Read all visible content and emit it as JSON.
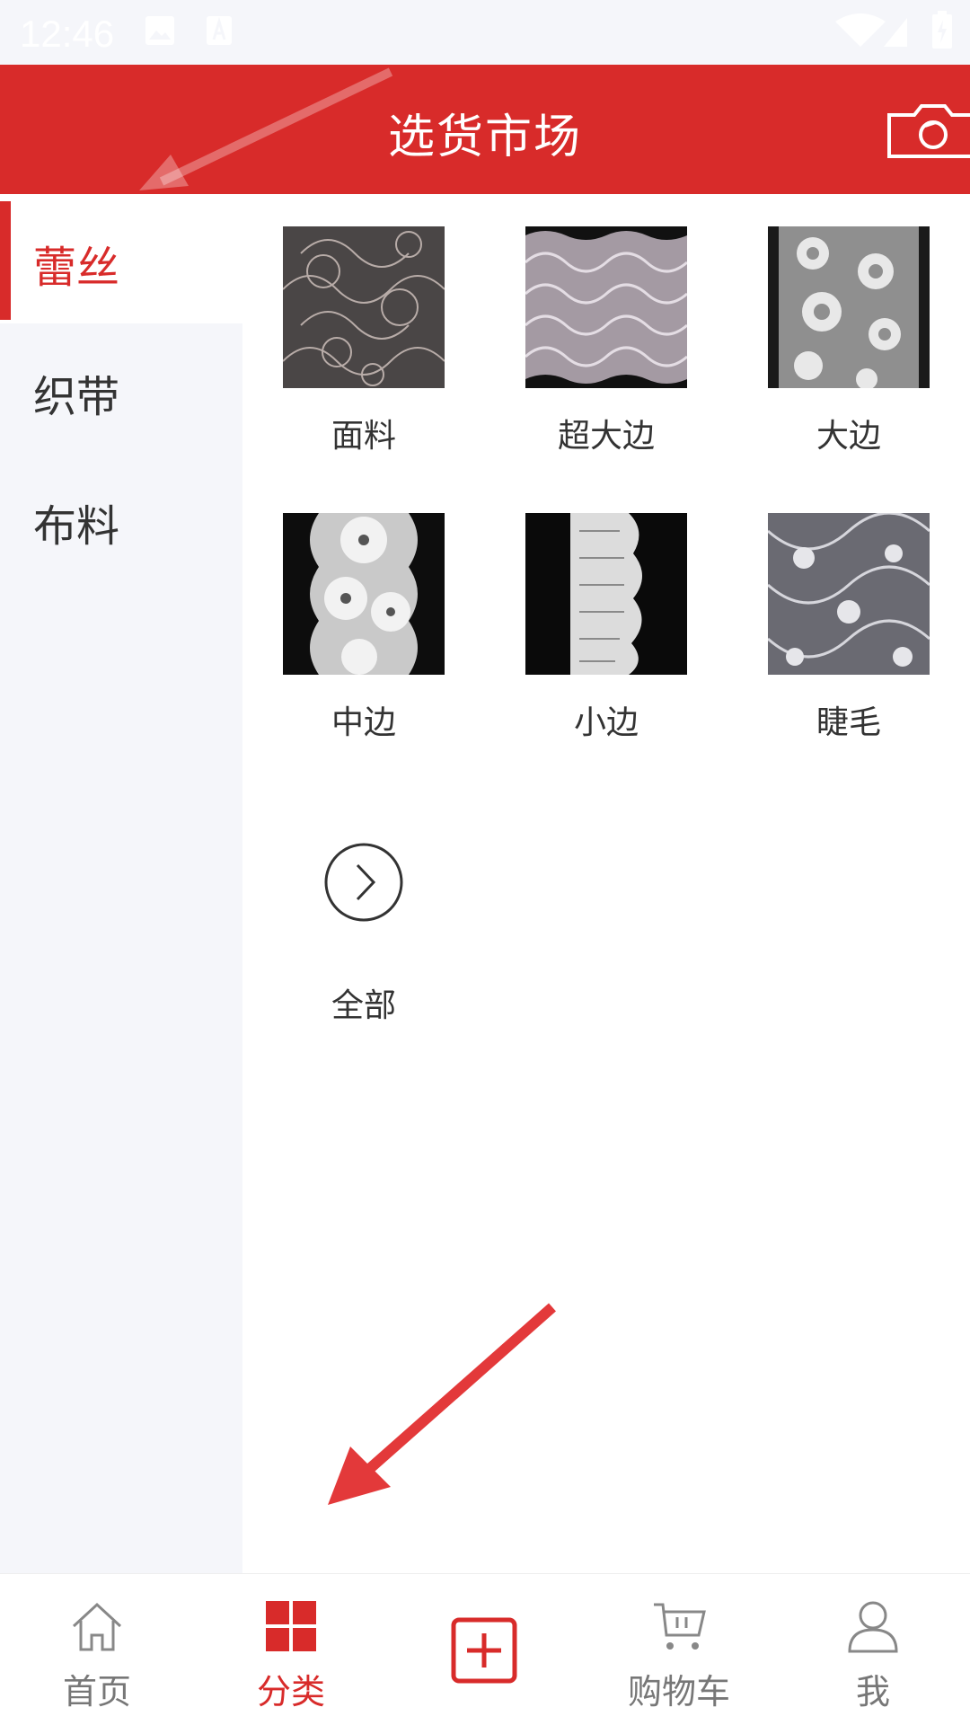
{
  "status_bar": {
    "time": "12:46"
  },
  "header": {
    "title": "选货市场",
    "camera_icon": "camera-icon"
  },
  "sidebar": {
    "items": [
      {
        "label": "蕾丝",
        "active": true
      },
      {
        "label": "织带",
        "active": false
      },
      {
        "label": "布料",
        "active": false
      }
    ]
  },
  "grid": {
    "items": [
      {
        "label": "面料"
      },
      {
        "label": "超大边"
      },
      {
        "label": "大边"
      },
      {
        "label": "中边"
      },
      {
        "label": "小边"
      },
      {
        "label": "睫毛"
      }
    ],
    "all": {
      "label": "全部",
      "icon": "chevron-right-circle-icon"
    }
  },
  "bottom_nav": {
    "tabs": [
      {
        "label": "首页",
        "icon": "home-icon",
        "active": false
      },
      {
        "label": "分类",
        "icon": "category-grid-icon",
        "active": true
      },
      {
        "label": "",
        "icon": "plus-box-icon",
        "active": false
      },
      {
        "label": "购物车",
        "icon": "cart-icon",
        "active": false
      },
      {
        "label": "我",
        "icon": "user-icon",
        "active": false
      }
    ]
  },
  "colors": {
    "brand_red": "#d82b2a",
    "sidebar_bg": "#f5f6fa",
    "text": "#333333",
    "inactive": "#777777"
  }
}
